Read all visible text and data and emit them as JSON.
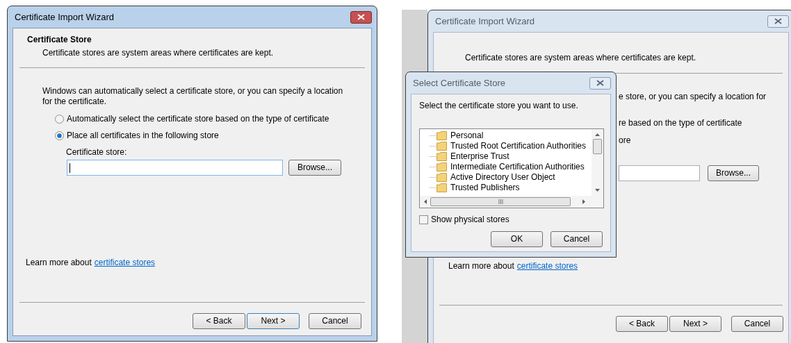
{
  "windows": [
    {
      "title": "Certificate Import Wizard",
      "active": true,
      "heading": "Certificate Store",
      "description": "Certificate stores are system areas where certificates are kept.",
      "intro": "Windows can automatically select a certificate store, or you can specify a location for the certificate.",
      "options": [
        {
          "label": "Automatically select the certificate store based on the type of certificate",
          "selected": false
        },
        {
          "label": "Place all certificates in the following store",
          "selected": true
        }
      ],
      "store_field": {
        "label": "Certificate store:",
        "focused": true
      },
      "browse": "Browse...",
      "learn_more": {
        "text": "Learn more about",
        "link": "certificate stores"
      },
      "buttons": [
        {
          "label": "< Back",
          "default": false
        },
        {
          "label": "Next >",
          "default": true
        },
        {
          "label": "Cancel",
          "default": false
        }
      ]
    },
    {
      "title": "Certificate Import Wizard",
      "active": false,
      "description": "Certificate stores are system areas where certificates are kept.",
      "fragments": [
        "e store, or you can specify a location for",
        "re based on the type of certificate",
        "ore"
      ],
      "store_field": {
        "focused": false
      },
      "browse": "Browse...",
      "learn_more": {
        "text": "Learn more about",
        "link": "certificate stores"
      },
      "buttons": [
        "< Back",
        "Next >",
        "Cancel"
      ]
    }
  ],
  "dialog": {
    "title": "Select Certificate Store",
    "active": false,
    "prompt": "Select the certificate store you want to use.",
    "stores": [
      "Personal",
      "Trusted Root Certification Authorities",
      "Enterprise Trust",
      "Intermediate Certification Authorities",
      "Active Directory User Object",
      "Trusted Publishers"
    ],
    "checkbox": {
      "label": "Show physical stores",
      "checked": false
    },
    "buttons": [
      "OK",
      "Cancel"
    ]
  }
}
